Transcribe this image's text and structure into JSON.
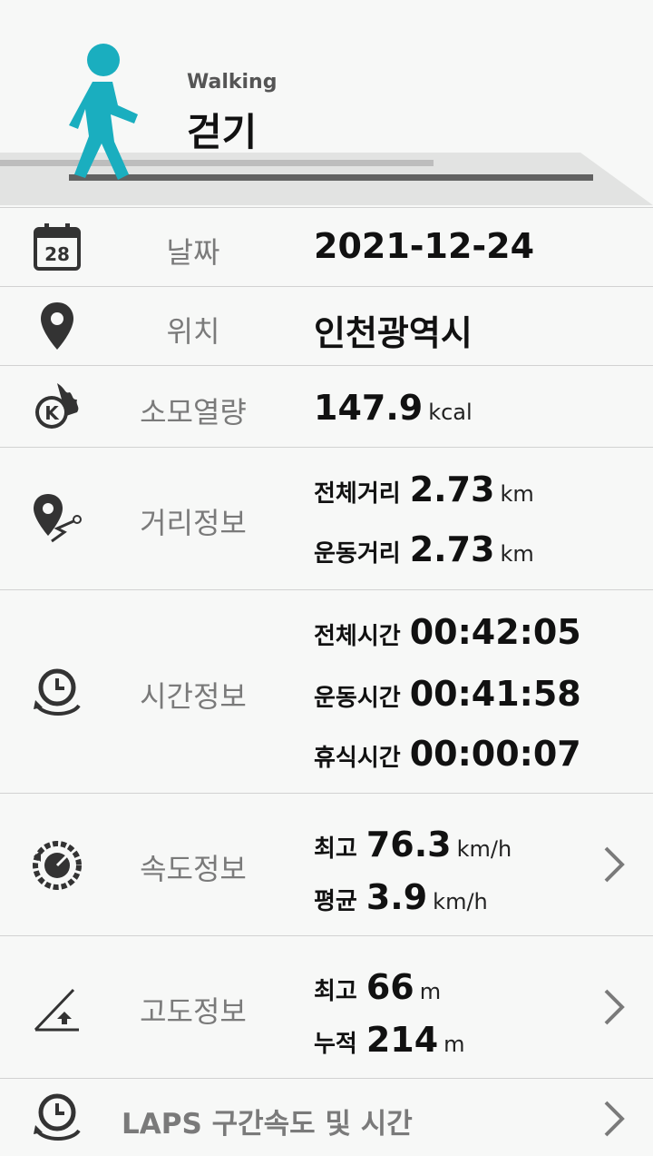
{
  "header": {
    "subtitle": "Walking",
    "title": "걷기"
  },
  "rows": {
    "date": {
      "label": "날짜",
      "value": "2021-12-24",
      "icon": "calendar-icon",
      "icon_text": "28"
    },
    "location": {
      "label": "위치",
      "value": "인천광역시",
      "icon": "location-pin-icon"
    },
    "calories": {
      "label": "소모열량",
      "value": "147.9",
      "unit": "kcal",
      "icon": "calorie-flame-icon",
      "icon_text": "K"
    },
    "distance": {
      "label": "거리정보",
      "icon": "distance-route-icon",
      "total_label": "전체거리",
      "total_value": "2.73",
      "total_unit": "km",
      "exercise_label": "운동거리",
      "exercise_value": "2.73",
      "exercise_unit": "km"
    },
    "time": {
      "label": "시간정보",
      "icon": "clock-icon",
      "total_label": "전체시간",
      "total_value": "00:42:05",
      "exercise_label": "운동시간",
      "exercise_value": "00:41:58",
      "rest_label": "휴식시간",
      "rest_value": "00:00:07"
    },
    "speed": {
      "label": "속도정보",
      "icon": "speedometer-icon",
      "max_label": "최고",
      "max_value": "76.3",
      "max_unit": "km/h",
      "avg_label": "평균",
      "avg_value": "3.9",
      "avg_unit": "km/h"
    },
    "altitude": {
      "label": "고도정보",
      "icon": "altitude-slope-icon",
      "max_label": "최고",
      "max_value": "66",
      "max_unit": "m",
      "cum_label": "누적",
      "cum_value": "214",
      "cum_unit": "m"
    },
    "laps": {
      "label": "LAPS 구간속도 및 시간",
      "icon": "laps-clock-icon"
    }
  },
  "colors": {
    "accent": "#1aaebf",
    "label_gray": "#7a7a7a",
    "divider": "#d2d2d2"
  }
}
